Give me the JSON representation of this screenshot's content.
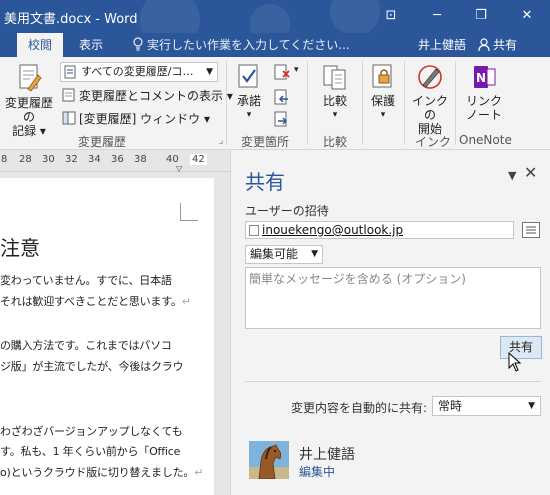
{
  "window": {
    "title": "美用文書.docx - Word",
    "controls": {
      "ribbon_options": "⊡",
      "minimize": "─",
      "restore": "❐",
      "close": "✕"
    }
  },
  "tabs": [
    {
      "label": "校閲",
      "active": true
    },
    {
      "label": "表示",
      "active": false
    }
  ],
  "tell_me": "実行したい作業を入力してください...",
  "user": {
    "name": "井上健語",
    "share_label": "共有"
  },
  "ribbon": {
    "tracking": {
      "big_button_line1": "変更履歴の",
      "big_button_line2": "記録",
      "markup_dropdown": "すべての変更履歴/コ…",
      "show_markup": "変更履歴とコメントの表示",
      "reviewing_pane": "[変更履歴] ウィンドウ",
      "group_label": "変更履歴"
    },
    "changes": {
      "accept_label": "承諾",
      "group_label": "変更箇所"
    },
    "compare": {
      "label": "比較",
      "group_label": "比較"
    },
    "protect": {
      "label": "保護"
    },
    "ink": {
      "label_line1": "インクの",
      "label_line2": "開始",
      "group_label": "インク"
    },
    "onenote": {
      "label_line1": "リンク",
      "label_line2": "ノート",
      "group_label": "OneNote"
    }
  },
  "ruler": {
    "ticks": [
      "8",
      "28",
      "30",
      "32",
      "34",
      "36",
      "38",
      "40",
      "42"
    ]
  },
  "document": {
    "heading": "注意",
    "lines": [
      "変わっていません。すでに、日本語",
      "それは歓迎すべきことだと思います。",
      "",
      "の購入方法です。これまではパソコ",
      "ジ版」が主流でしたが、今後はクラウ",
      "",
      "わざわざバージョンアップしなくても",
      "す。私も、1 年くらい前から「Office",
      "o)というクラウド版に切り替えました。"
    ],
    "line_pilcrows": [
      false,
      true,
      false,
      false,
      false,
      false,
      false,
      false,
      true
    ]
  },
  "share_pane": {
    "title": "共有",
    "invite_label": "ユーザーの招待",
    "invite_value": "inouekengo@outlook.jp",
    "permission": "編集可能",
    "message_placeholder": "簡単なメッセージを含める (オプション)",
    "share_button": "共有",
    "auto_share_label": "変更内容を自動的に共有:",
    "auto_share_value": "常時",
    "person": {
      "name": "井上健語",
      "status": "編集中"
    }
  },
  "colors": {
    "accent": "#2b579a",
    "ribbon_bg": "#f3f3f3",
    "pane_bg": "#f3f3f3"
  }
}
